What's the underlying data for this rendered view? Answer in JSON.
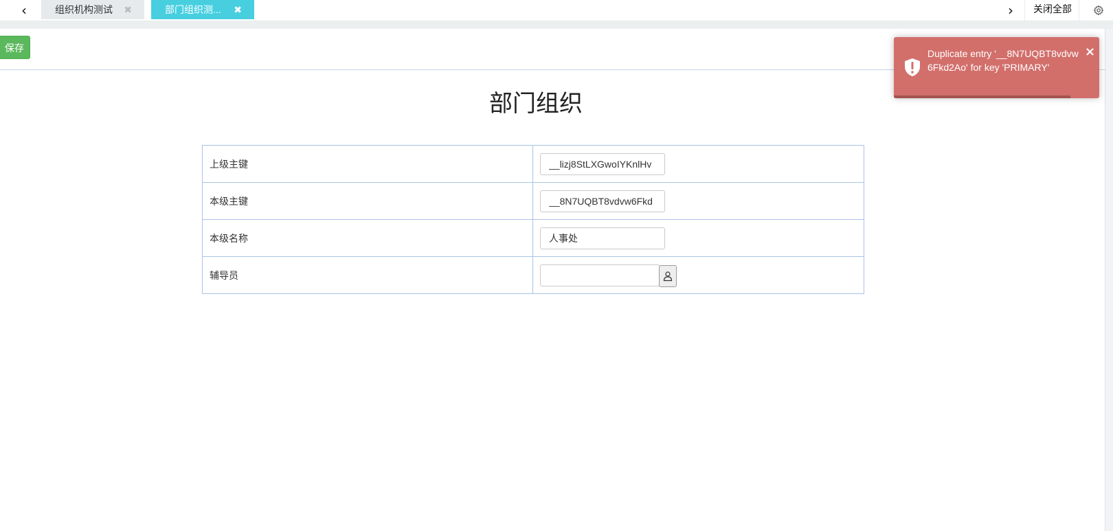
{
  "tabs": {
    "tab1_label": "组织机构测试",
    "tab2_label": "部门组织测...",
    "close_all": "关闭全部",
    "close_glyph": "✖"
  },
  "nav": {
    "prev_glyph": "‹",
    "next_glyph": "›"
  },
  "toolbar": {
    "save_label": "保存"
  },
  "page": {
    "title": "部门组织"
  },
  "form": {
    "rows": [
      {
        "label": "上级主键",
        "value": "__lizj8StLXGwoIYKnlHv"
      },
      {
        "label": "本级主键",
        "value": "__8N7UQBT8vdvw6Fkd"
      },
      {
        "label": "本级名称",
        "value": "人事处"
      },
      {
        "label": "辅导员",
        "value": ""
      }
    ]
  },
  "toast": {
    "message": "Duplicate entry '__8N7UQBT8vdvw6Fkd2Ao' for key 'PRIMARY'",
    "close_glyph": "×",
    "progress": 0.86
  },
  "colors": {
    "active_tab": "#47cfe0",
    "save_button": "#5cb85c",
    "toast_bg": "#d26f6b",
    "table_border": "#a8c4e6"
  },
  "icons": {
    "prev": "chevron-left-icon",
    "next": "chevron-right-icon",
    "settings": "gear-icon",
    "picker": "user-icon",
    "toast": "shield-alert-icon"
  }
}
